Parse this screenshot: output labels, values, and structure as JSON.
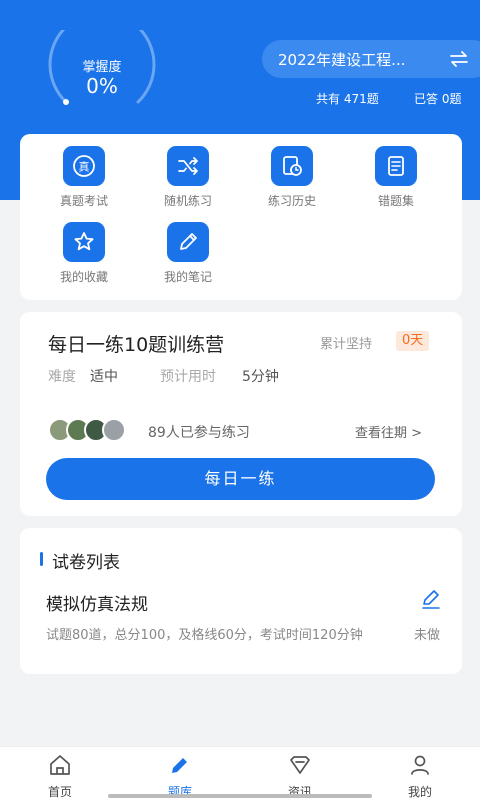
{
  "header": {
    "mastery_title": "掌握度",
    "mastery_value": "0%",
    "mastery_fraction": 0,
    "subject": "2022年建设工程...",
    "total_questions": "共有 471题",
    "answered_questions": "已答 0题"
  },
  "tools": [
    {
      "label": "真题考试",
      "icon": "exam-paper-icon"
    },
    {
      "label": "随机练习",
      "icon": "shuffle-icon"
    },
    {
      "label": "练习历史",
      "icon": "history-icon"
    },
    {
      "label": "错题集",
      "icon": "wrong-questions-icon"
    },
    {
      "label": "我的收藏",
      "icon": "star-icon"
    },
    {
      "label": "我的笔记",
      "icon": "pencil-icon"
    }
  ],
  "daily": {
    "title": "每日一练10题训练营",
    "persist_label": "累计坚持",
    "persist_days": "0天",
    "difficulty_label": "难度",
    "difficulty_value": "适中",
    "time_label": "预计用时",
    "time_value": "5分钟",
    "participants": "89人已参与练习",
    "history_link": "查看往期 >",
    "button_label": "每日一练"
  },
  "papers": {
    "section_title": "试卷列表",
    "items": [
      {
        "title": "模拟仿真法规",
        "description": "试题80道，总分100，及格线60分，考试时间120分钟",
        "status": "未做"
      }
    ]
  },
  "tabbar": [
    {
      "label": "首页",
      "icon": "home-icon",
      "active": false
    },
    {
      "label": "题库",
      "icon": "question-bank-icon",
      "active": true
    },
    {
      "label": "资讯",
      "icon": "news-icon",
      "active": false
    },
    {
      "label": "我的",
      "icon": "profile-icon",
      "active": false
    }
  ],
  "colors": {
    "primary": "#1a73e8",
    "badge_bg": "#fde8dc",
    "badge_text": "#f56b1e"
  }
}
